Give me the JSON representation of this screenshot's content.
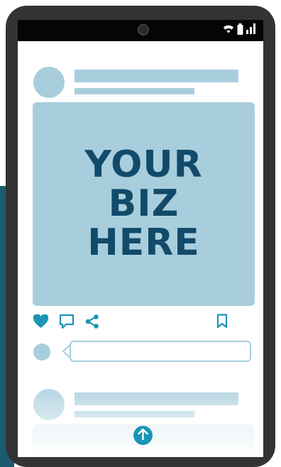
{
  "post": {
    "image_text": "YOUR\nBIZ\nHERE"
  },
  "comment": {
    "value": ""
  },
  "icons": {
    "status": [
      "wifi-icon",
      "battery-icon",
      "signal-icon"
    ],
    "actions": [
      "heart-icon",
      "comment-icon",
      "share-icon",
      "bookmark-icon"
    ],
    "scroll": "arrow-up-icon"
  },
  "colors": {
    "placeholder": "#a8cedd",
    "brand_text": "#124a6a",
    "accent": "#1b95b5",
    "phone_body": "#333333",
    "backdrop": "#1c5a6f"
  }
}
